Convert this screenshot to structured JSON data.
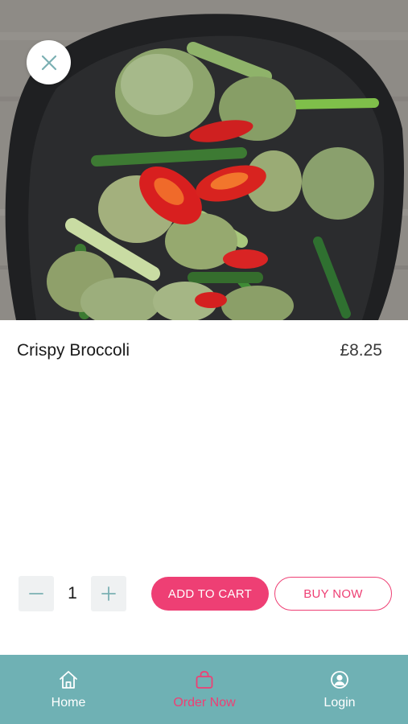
{
  "hero": {
    "image_name": "crispy-broccoli-photo",
    "close_icon": "close-icon"
  },
  "product": {
    "name": "Crispy Broccoli",
    "price": "£8.25"
  },
  "quantity": {
    "value": "1",
    "minus_icon": "minus-icon",
    "plus_icon": "plus-icon"
  },
  "actions": {
    "add_to_cart": "ADD TO CART",
    "buy_now": "BUY NOW"
  },
  "tabbar": {
    "items": [
      {
        "label": "Home",
        "icon": "home-icon",
        "active": false
      },
      {
        "label": "Order Now",
        "icon": "bag-icon",
        "active": true
      },
      {
        "label": "Login",
        "icon": "user-circle-icon",
        "active": false
      }
    ]
  },
  "colors": {
    "accent": "#ee3f74",
    "tabbar_bg": "#6fb1b4",
    "icon_teal": "#7bb0b3",
    "stepper_bg": "#eff1f2"
  }
}
